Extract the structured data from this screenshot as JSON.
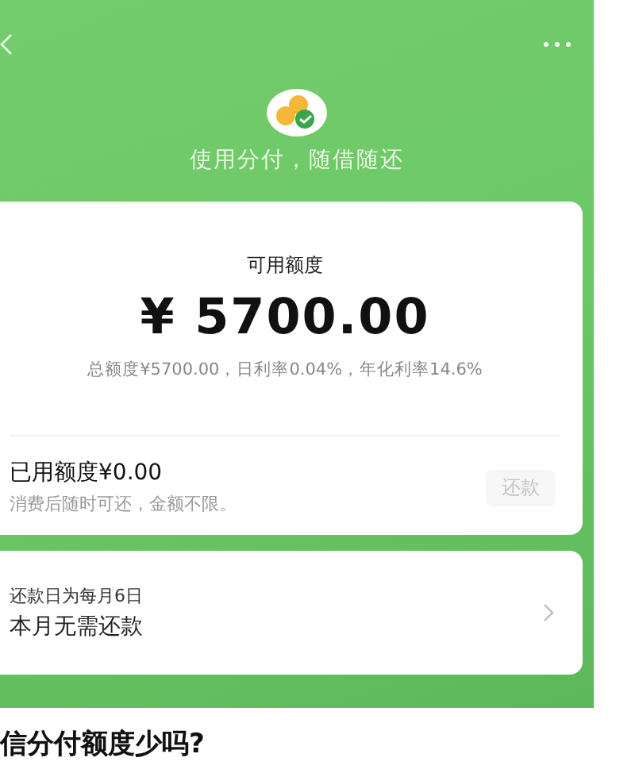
{
  "header": {
    "tagline": "使用分付，随借随还"
  },
  "credit_card": {
    "label": "可用额度",
    "amount": "¥ 5700.00",
    "details": "总额度¥5700.00，日利率0.04%，年化利率14.6%",
    "used": "已用额度¥0.00",
    "used_note": "消费后随时可还，金额不限。",
    "repay_button": {
      "label": "还款",
      "disabled": true
    }
  },
  "repayment_card": {
    "due_day": "还款日为每月6日",
    "status": "本月无需还款"
  },
  "article_heading": "信分付额度少吗?"
}
